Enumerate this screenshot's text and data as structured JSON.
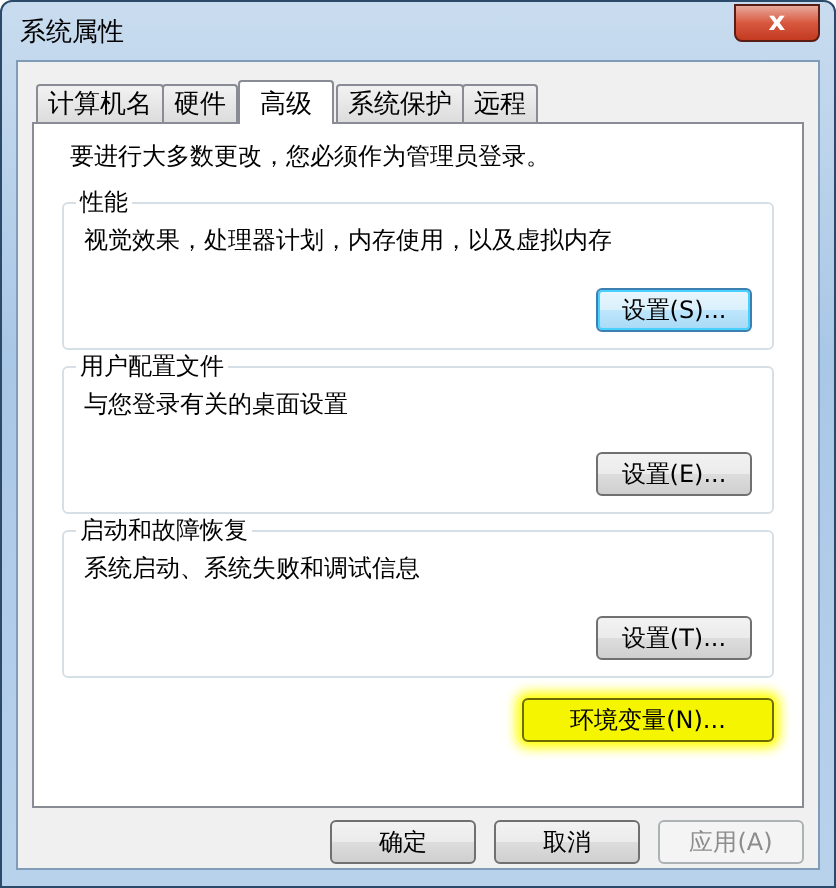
{
  "window": {
    "title": "系统属性",
    "close": "x"
  },
  "tabs": [
    {
      "label": "计算机名",
      "selected": false
    },
    {
      "label": "硬件",
      "selected": false
    },
    {
      "label": "高级",
      "selected": true
    },
    {
      "label": "系统保护",
      "selected": false
    },
    {
      "label": "远程",
      "selected": false
    }
  ],
  "notice": "要进行大多数更改，您必须作为管理员登录。",
  "groups": [
    {
      "title": "性能",
      "description": "视觉效果，处理器计划，内存使用，以及虚拟内存",
      "button": {
        "label": "设置(S)...",
        "focused": true
      }
    },
    {
      "title": "用户配置文件",
      "description": "与您登录有关的桌面设置",
      "button": {
        "label": "设置(E)...",
        "focused": false
      }
    },
    {
      "title": "启动和故障恢复",
      "description": "系统启动、系统失败和调试信息",
      "button": {
        "label": "设置(T)...",
        "focused": false
      }
    }
  ],
  "environment_button": {
    "label": "环境变量(N)...",
    "highlighted": true
  },
  "buttons": [
    {
      "label": "确定",
      "disabled": false
    },
    {
      "label": "取消",
      "disabled": false
    },
    {
      "label": "应用(A)",
      "disabled": true
    }
  ]
}
